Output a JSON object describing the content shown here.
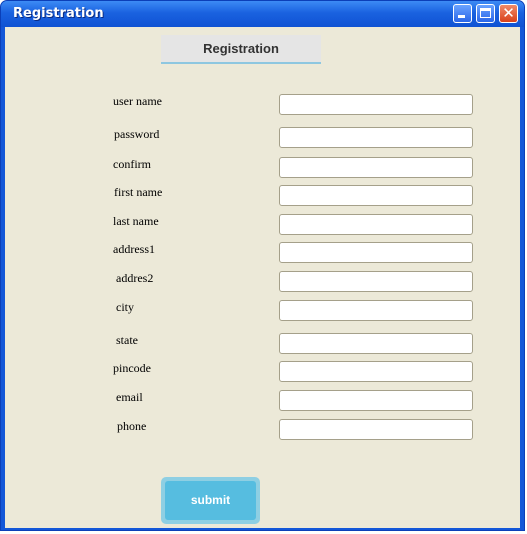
{
  "window": {
    "title": "Registration",
    "controls": [
      "minimize-icon",
      "maximize-icon",
      "close-icon"
    ]
  },
  "header": {
    "label": "Registration"
  },
  "form": {
    "fields": [
      {
        "label": "user name",
        "value": ""
      },
      {
        "label": "password",
        "value": ""
      },
      {
        "label": "confirm",
        "value": ""
      },
      {
        "label": "first name",
        "value": ""
      },
      {
        "label": "last name",
        "value": ""
      },
      {
        "label": "address1",
        "value": ""
      },
      {
        "label": "addres2",
        "value": ""
      },
      {
        "label": "city",
        "value": ""
      },
      {
        "label": "state",
        "value": ""
      },
      {
        "label": "pincode",
        "value": ""
      },
      {
        "label": "email",
        "value": ""
      },
      {
        "label": "phone",
        "value": ""
      }
    ],
    "submit_label": "submit"
  },
  "colors": {
    "titlebar": "#0f52d3",
    "client_bg": "#ece9d8",
    "submit_bg": "#56bde0",
    "submit_glow": "#8ecfe3"
  }
}
